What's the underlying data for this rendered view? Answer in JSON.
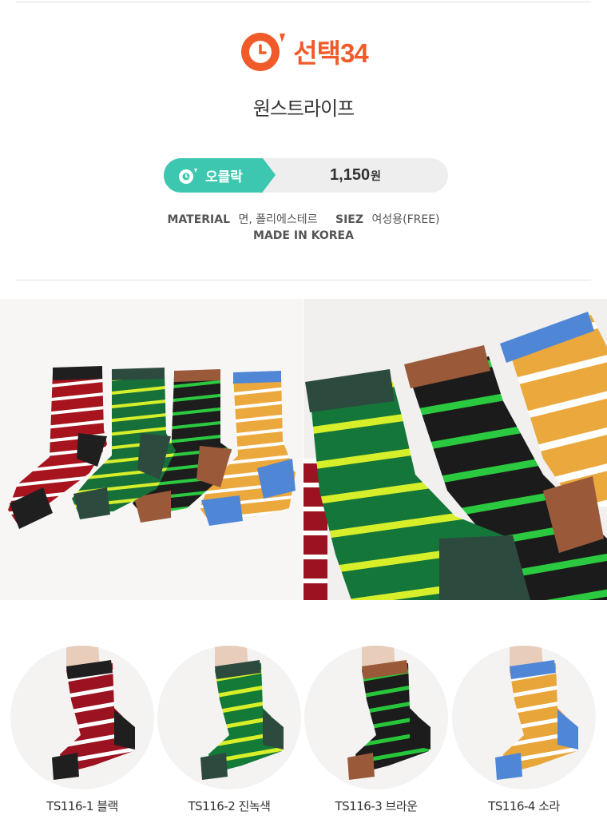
{
  "brand": {
    "name": "선택34",
    "accent": "#f15a29"
  },
  "product": {
    "name": "원스트라이프"
  },
  "price": {
    "tag_label": "오클락",
    "tag_color": "#3dc7b0",
    "amount": "1,150",
    "unit": "원"
  },
  "spec": {
    "material_label": "MATERIAL",
    "material_value": "면, 폴리에스테르",
    "size_label": "SIEZ",
    "size_value": "여성용(FREE)",
    "origin": "MADE IN KOREA"
  },
  "variants": [
    {
      "code": "TS116-1 블랙",
      "body": "#9b1320",
      "stripe": "#ffffff",
      "cuff": "#1f1f1f",
      "heel": "#1f1f1f"
    },
    {
      "code": "TS116-2 진녹색",
      "body": "#137a38",
      "stripe": "#d8ef2a",
      "cuff": "#2d4a3e",
      "heel": "#2d4a3e"
    },
    {
      "code": "TS116-3 브라운",
      "body": "#1c1c1c",
      "stripe": "#27c63a",
      "cuff": "#9a5a3a",
      "heel": "#9a5a3a"
    },
    {
      "code": "TS116-4 소라",
      "body": "#e8a63a",
      "stripe": "#ffffff",
      "cuff": "#4f86d6",
      "heel": "#4f86d6"
    }
  ]
}
